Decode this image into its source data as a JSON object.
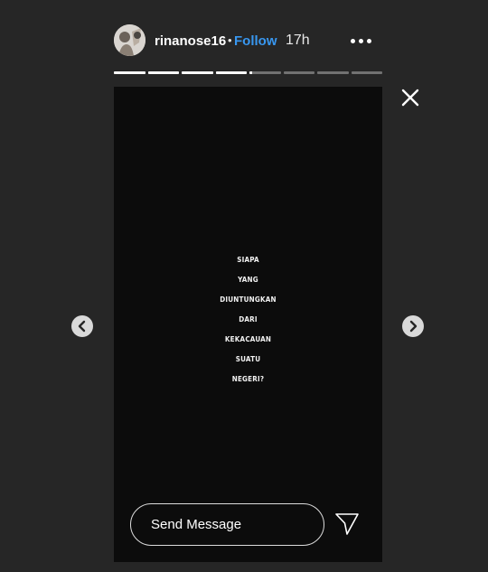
{
  "header": {
    "username": "rinanose16",
    "separator": "•",
    "follow_label": "Follow",
    "timestamp": "17h",
    "more_icon": "more-horizontal-icon",
    "avatar_icon": "avatar-photo"
  },
  "progress": {
    "segments": 8,
    "active_index": 4,
    "active_fraction": 0.1
  },
  "story": {
    "lines": [
      "SIAPA",
      "YANG",
      "DIUNTUNGKAN",
      "DARI",
      "KEKACAUAN",
      "SUATU",
      "NEGERI?"
    ],
    "background_color": "#0c0c0c"
  },
  "reply": {
    "placeholder": "Send Message",
    "send_icon": "send-paper-plane-icon"
  },
  "controls": {
    "close_icon": "close-icon",
    "prev_icon": "chevron-left-icon",
    "next_icon": "chevron-right-icon"
  },
  "colors": {
    "page_background": "#262626",
    "follow_link": "#3897f0",
    "nav_button": "#d9d9d9"
  }
}
